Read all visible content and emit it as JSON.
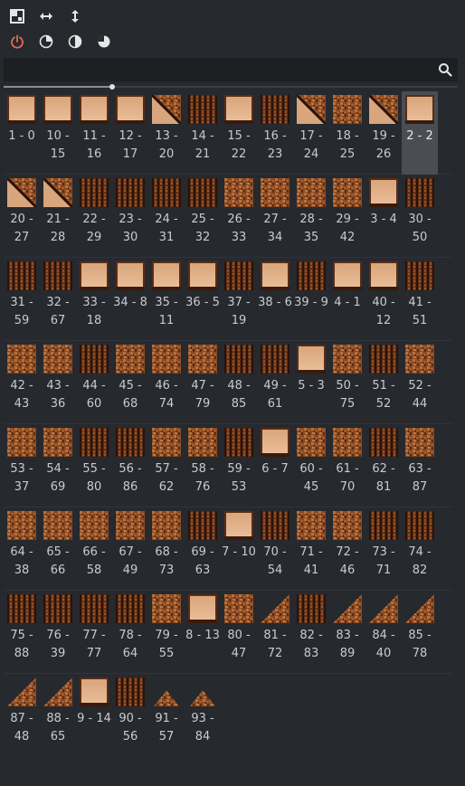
{
  "toolbar": {
    "row1": [
      {
        "icon": "grid-icon",
        "name": "grid-button"
      },
      {
        "icon": "horizontal-arrows-icon",
        "name": "fit-width-button"
      },
      {
        "icon": "vertical-arrows-icon",
        "name": "fit-height-button"
      }
    ],
    "row2": [
      {
        "icon": "power-icon",
        "name": "power-button",
        "active": true
      },
      {
        "icon": "pie-quarter-icon",
        "name": "pie-quarter-button"
      },
      {
        "icon": "half-circle-icon",
        "name": "half-circle-button"
      },
      {
        "icon": "pie-three-quarter-icon",
        "name": "pie-three-quarter-button"
      }
    ]
  },
  "search": {
    "value": "",
    "placeholder": ""
  },
  "zoom": {
    "fraction": 0.24
  },
  "colors": {
    "accent_active": "#e06c5a",
    "selected_bg": "#4a4d53"
  },
  "tiles": [
    {
      "label": "1 - 0",
      "style": "plank"
    },
    {
      "label": "10 - 15",
      "style": "plank"
    },
    {
      "label": "11 - 16",
      "style": "plank"
    },
    {
      "label": "12 - 17",
      "style": "plank"
    },
    {
      "label": "13 - 20",
      "style": "diag"
    },
    {
      "label": "14 - 21",
      "style": "dark"
    },
    {
      "label": "15 - 22",
      "style": "plank"
    },
    {
      "label": "16 - 23",
      "style": "dark"
    },
    {
      "label": "17 - 24",
      "style": "diag"
    },
    {
      "label": "18 - 25",
      "style": "bark"
    },
    {
      "label": "19 - 26",
      "style": "diag"
    },
    {
      "label": "2 - 2",
      "style": "plank",
      "selected": true
    },
    {
      "label": "20 - 27",
      "style": "diag"
    },
    {
      "label": "21 - 28",
      "style": "diag"
    },
    {
      "label": "22 - 29",
      "style": "dark"
    },
    {
      "label": "23 - 30",
      "style": "dark"
    },
    {
      "label": "24 - 31",
      "style": "dark"
    },
    {
      "label": "25 - 32",
      "style": "dark"
    },
    {
      "label": "26 - 33",
      "style": "bark"
    },
    {
      "label": "27 - 34",
      "style": "bark"
    },
    {
      "label": "28 - 35",
      "style": "bark"
    },
    {
      "label": "29 - 42",
      "style": "bark"
    },
    {
      "label": "3 - 4",
      "style": "plank"
    },
    {
      "label": "30 - 50",
      "style": "dark"
    },
    {
      "label": "31 - 59",
      "style": "dark"
    },
    {
      "label": "32 - 67",
      "style": "dark"
    },
    {
      "label": "33 - 18",
      "style": "plank"
    },
    {
      "label": "34 - 8",
      "style": "plank"
    },
    {
      "label": "35 - 11",
      "style": "plank"
    },
    {
      "label": "36 - 5",
      "style": "plank"
    },
    {
      "label": "37 - 19",
      "style": "dark"
    },
    {
      "label": "38 - 6",
      "style": "plank"
    },
    {
      "label": "39 - 9",
      "style": "dark"
    },
    {
      "label": "4 - 1",
      "style": "plank"
    },
    {
      "label": "40 - 12",
      "style": "plank"
    },
    {
      "label": "41 - 51",
      "style": "dark"
    },
    {
      "label": "42 - 43",
      "style": "bark"
    },
    {
      "label": "43 - 36",
      "style": "bark"
    },
    {
      "label": "44 - 60",
      "style": "dark"
    },
    {
      "label": "45 - 68",
      "style": "bark"
    },
    {
      "label": "46 - 74",
      "style": "bark"
    },
    {
      "label": "47 - 79",
      "style": "bark"
    },
    {
      "label": "48 - 85",
      "style": "dark"
    },
    {
      "label": "49 - 61",
      "style": "dark"
    },
    {
      "label": "5 - 3",
      "style": "plank"
    },
    {
      "label": "50 - 75",
      "style": "bark"
    },
    {
      "label": "51 - 52",
      "style": "dark"
    },
    {
      "label": "52 - 44",
      "style": "bark"
    },
    {
      "label": "53 - 37",
      "style": "bark"
    },
    {
      "label": "54 - 69",
      "style": "bark"
    },
    {
      "label": "55 - 80",
      "style": "dark"
    },
    {
      "label": "56 - 86",
      "style": "dark"
    },
    {
      "label": "57 - 62",
      "style": "bark"
    },
    {
      "label": "58 - 76",
      "style": "bark"
    },
    {
      "label": "59 - 53",
      "style": "dark"
    },
    {
      "label": "6 - 7",
      "style": "plank"
    },
    {
      "label": "60 - 45",
      "style": "bark"
    },
    {
      "label": "61 - 70",
      "style": "bark"
    },
    {
      "label": "62 - 81",
      "style": "dark"
    },
    {
      "label": "63 - 87",
      "style": "bark"
    },
    {
      "label": "64 - 38",
      "style": "bark"
    },
    {
      "label": "65 - 66",
      "style": "bark"
    },
    {
      "label": "66 - 58",
      "style": "bark"
    },
    {
      "label": "67 - 49",
      "style": "bark"
    },
    {
      "label": "68 - 73",
      "style": "bark"
    },
    {
      "label": "69 - 63",
      "style": "dark"
    },
    {
      "label": "7 - 10",
      "style": "plank"
    },
    {
      "label": "70 - 54",
      "style": "dark"
    },
    {
      "label": "71 - 41",
      "style": "bark"
    },
    {
      "label": "72 - 46",
      "style": "bark"
    },
    {
      "label": "73 - 71",
      "style": "dark"
    },
    {
      "label": "74 - 82",
      "style": "dark"
    },
    {
      "label": "75 - 88",
      "style": "dark"
    },
    {
      "label": "76 - 39",
      "style": "dark"
    },
    {
      "label": "77 - 77",
      "style": "dark"
    },
    {
      "label": "78 - 64",
      "style": "dark"
    },
    {
      "label": "79 - 55",
      "style": "bark"
    },
    {
      "label": "8 - 13",
      "style": "plank"
    },
    {
      "label": "80 - 47",
      "style": "bark"
    },
    {
      "label": "81 - 72",
      "style": "tri"
    },
    {
      "label": "82 - 83",
      "style": "dark"
    },
    {
      "label": "83 - 89",
      "style": "tri"
    },
    {
      "label": "84 - 40",
      "style": "tri"
    },
    {
      "label": "85 - 78",
      "style": "tri"
    },
    {
      "label": "87 - 48",
      "style": "tri"
    },
    {
      "label": "88 - 65",
      "style": "tri"
    },
    {
      "label": "9 - 14",
      "style": "plank"
    },
    {
      "label": "90 - 56",
      "style": "dark"
    },
    {
      "label": "91 - 57",
      "style": "peak"
    },
    {
      "label": "93 - 84",
      "style": "peak"
    }
  ]
}
